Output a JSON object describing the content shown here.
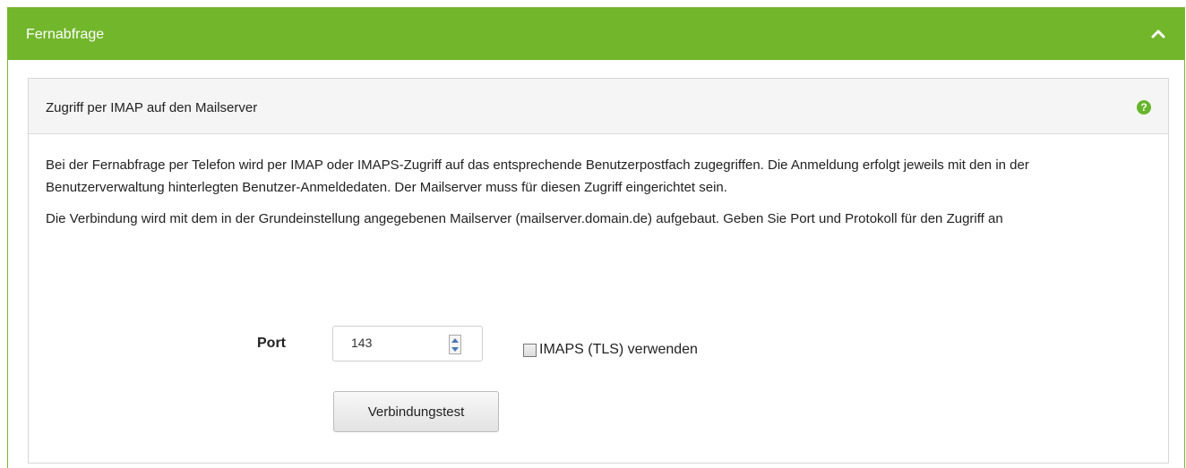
{
  "panel": {
    "title": "Fernabfrage",
    "icons": {
      "collapse": "chevron-up-icon",
      "help": "question-circle-icon"
    },
    "colors": {
      "header_green": "#72b62c",
      "help_green": "#67b52b"
    }
  },
  "section": {
    "title": "Zugriff per IMAP auf den Mailserver",
    "help_symbol": "?",
    "paragraph_1": "Bei der Fernabfrage per Telefon wird per IMAP oder IMAPS-Zugriff auf das entsprechende Benutzerpostfach zugegriffen. Die Anmeldung erfolgt jeweils mit den in der Benutzerverwaltung hinterlegten Benutzer-Anmeldedaten. Der Mailserver muss für diesen Zugriff eingerichtet sein.",
    "paragraph_2": "Die Verbindung wird mit dem in der Grundeinstellung angegebenen Mailserver (mailserver.domain.de) aufgebaut. Geben Sie Port und Protokoll für den Zugriff an"
  },
  "form": {
    "port_label": "Port",
    "port_value": "143",
    "imaps_label": "IMAPS (TLS) verwenden",
    "imaps_checked": false,
    "test_button_label": "Verbindungstest"
  }
}
